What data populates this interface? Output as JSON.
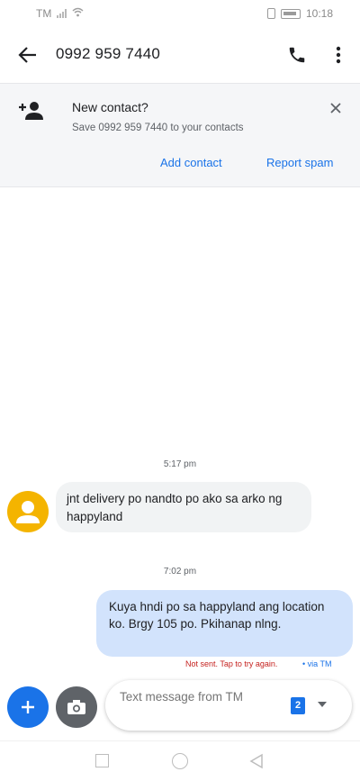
{
  "status_bar": {
    "carrier": "TM",
    "time": "10:18"
  },
  "app_bar": {
    "title": "0992 959 7440"
  },
  "banner": {
    "title": "New contact?",
    "subtitle": "Save 0992 959 7440 to your contacts",
    "add_contact_label": "Add contact",
    "report_spam_label": "Report spam"
  },
  "conversation": {
    "incoming": {
      "timestamp": "5:17 pm",
      "text": "jnt delivery po nandto po ako sa arko ng happyland"
    },
    "outgoing": {
      "timestamp": "7:02 pm",
      "text": "Kuya hndi po sa happyland ang location ko. Brgy 105 po. Pkihanap nlng.",
      "error_text": "Not sent. Tap to try again.",
      "via_text": "• via TM"
    }
  },
  "compose": {
    "placeholder": "Text message from TM",
    "sim_number": "2"
  },
  "colors": {
    "accent": "#1a73e8",
    "avatar": "#f4b400",
    "outgoing_bubble": "#d2e3fc",
    "incoming_bubble": "#f1f3f4",
    "error": "#c5221f"
  },
  "icons": {
    "back": "arrow-back-icon",
    "call": "phone-icon",
    "more": "more-vert-icon",
    "add_person": "person-add-icon",
    "close": "close-icon",
    "attach": "add-icon",
    "camera": "camera-icon",
    "sim_dropdown": "chevron-down-icon"
  }
}
